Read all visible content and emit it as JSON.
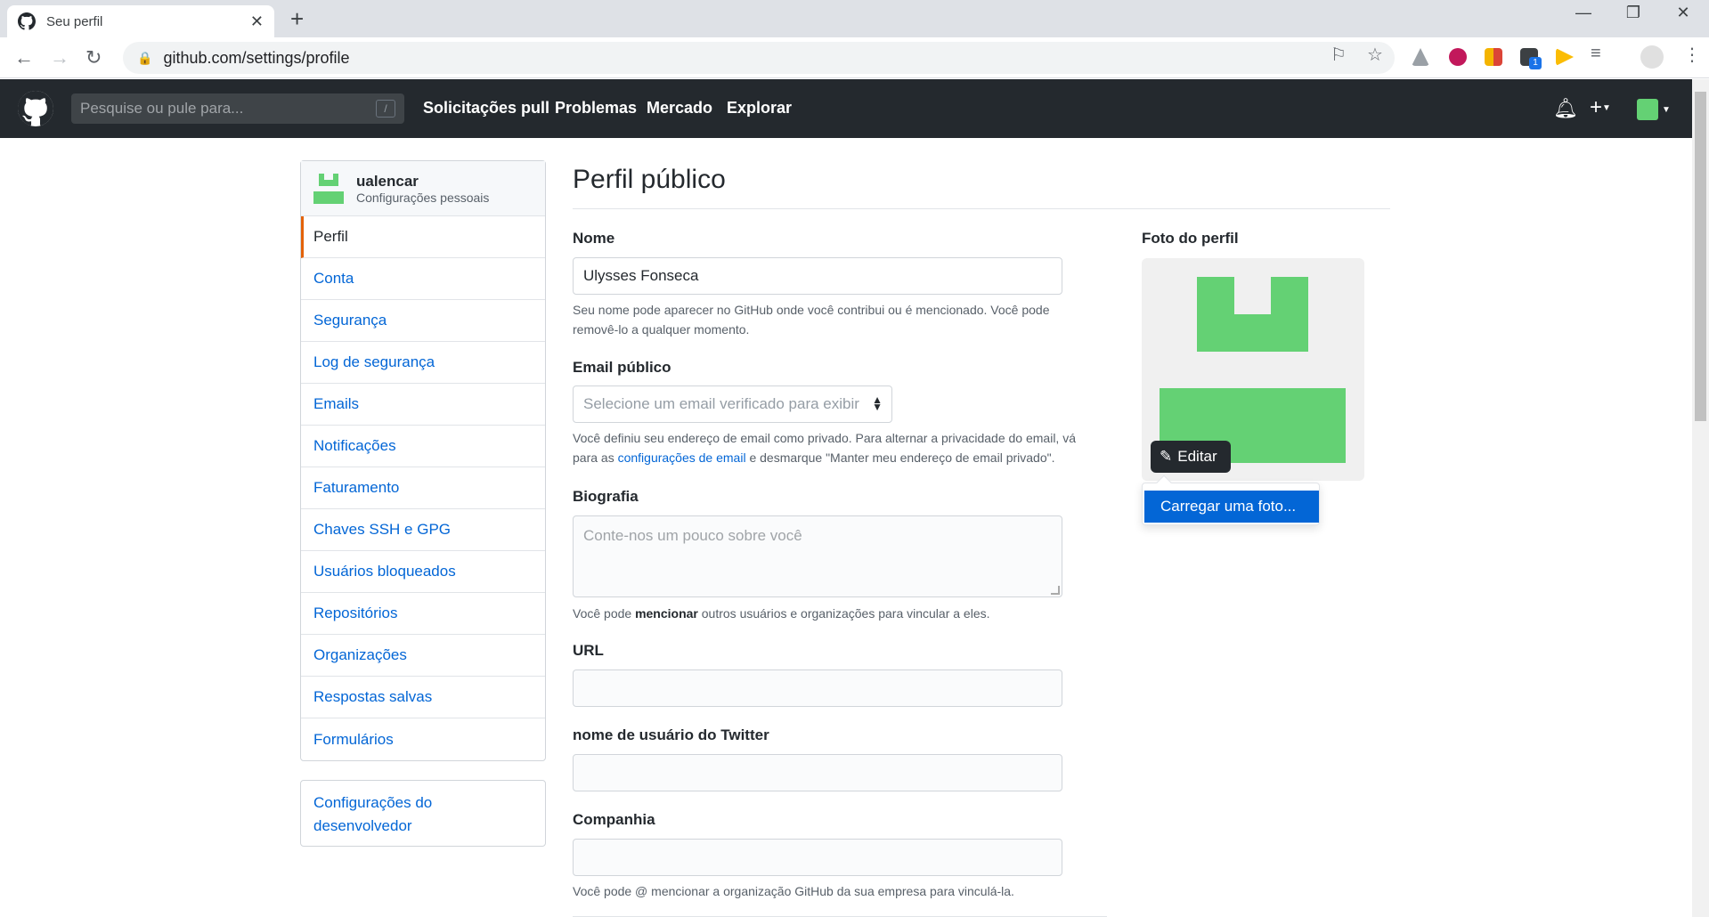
{
  "browser": {
    "tab_title": "Seu perfil",
    "url": "github.com/settings/profile",
    "extension_badge": "1"
  },
  "header": {
    "search_placeholder": "Pesquise ou pule para...",
    "search_shortcut": "/",
    "nav": [
      "Solicitações pull",
      "Problemas",
      "Mercado",
      "Explorar"
    ]
  },
  "sidebar": {
    "username": "ualencar",
    "subtitle": "Configurações pessoais",
    "items": [
      {
        "label": "Perfil",
        "active": true
      },
      {
        "label": "Conta"
      },
      {
        "label": "Segurança"
      },
      {
        "label": "Log de segurança"
      },
      {
        "label": "Emails"
      },
      {
        "label": "Notificações"
      },
      {
        "label": "Faturamento"
      },
      {
        "label": "Chaves SSH e GPG"
      },
      {
        "label": "Usuários bloqueados"
      },
      {
        "label": "Repositórios"
      },
      {
        "label": "Organizações"
      },
      {
        "label": "Respostas salvas"
      },
      {
        "label": "Formulários"
      }
    ],
    "developer_line1": "Configurações do",
    "developer_line2": "desenvolvedor"
  },
  "main": {
    "title": "Perfil público",
    "name_label": "Nome",
    "name_value": "Ulysses Fonseca",
    "name_note_1": "Seu nome pode aparecer no GitHub onde você contribui ou é mencionado. Você pode",
    "name_note_2": "removê-lo a qualquer momento.",
    "email_label": "Email público",
    "email_select": "Selecione um email verificado para exibir",
    "email_note_1": "Você definiu seu endereço de email como privado. Para alternar a privacidade do email, vá",
    "email_note_2a": "para as ",
    "email_note_link": "configurações de email",
    "email_note_2b": " e desmarque \"Manter meu endereço de email privado\".",
    "bio_label": "Biografia",
    "bio_placeholder": "Conte-nos um pouco sobre você",
    "bio_note_a": "Você pode ",
    "bio_note_b": "mencionar",
    "bio_note_c": " outros usuários e organizações para vincular a eles.",
    "url_label": "URL",
    "twitter_label": "nome de usuário do Twitter",
    "company_label": "Companhia",
    "company_note": "Você pode @ mencionar a organização GitHub da sua empresa para vinculá-la."
  },
  "photo": {
    "label": "Foto do perfil",
    "edit_label": "Editar",
    "upload_label": "Carregar uma foto...",
    "avatar_color": "#64d174"
  },
  "colors": {
    "header_bg": "#24292e",
    "link": "#0366d6",
    "active_marker": "#e36209"
  }
}
